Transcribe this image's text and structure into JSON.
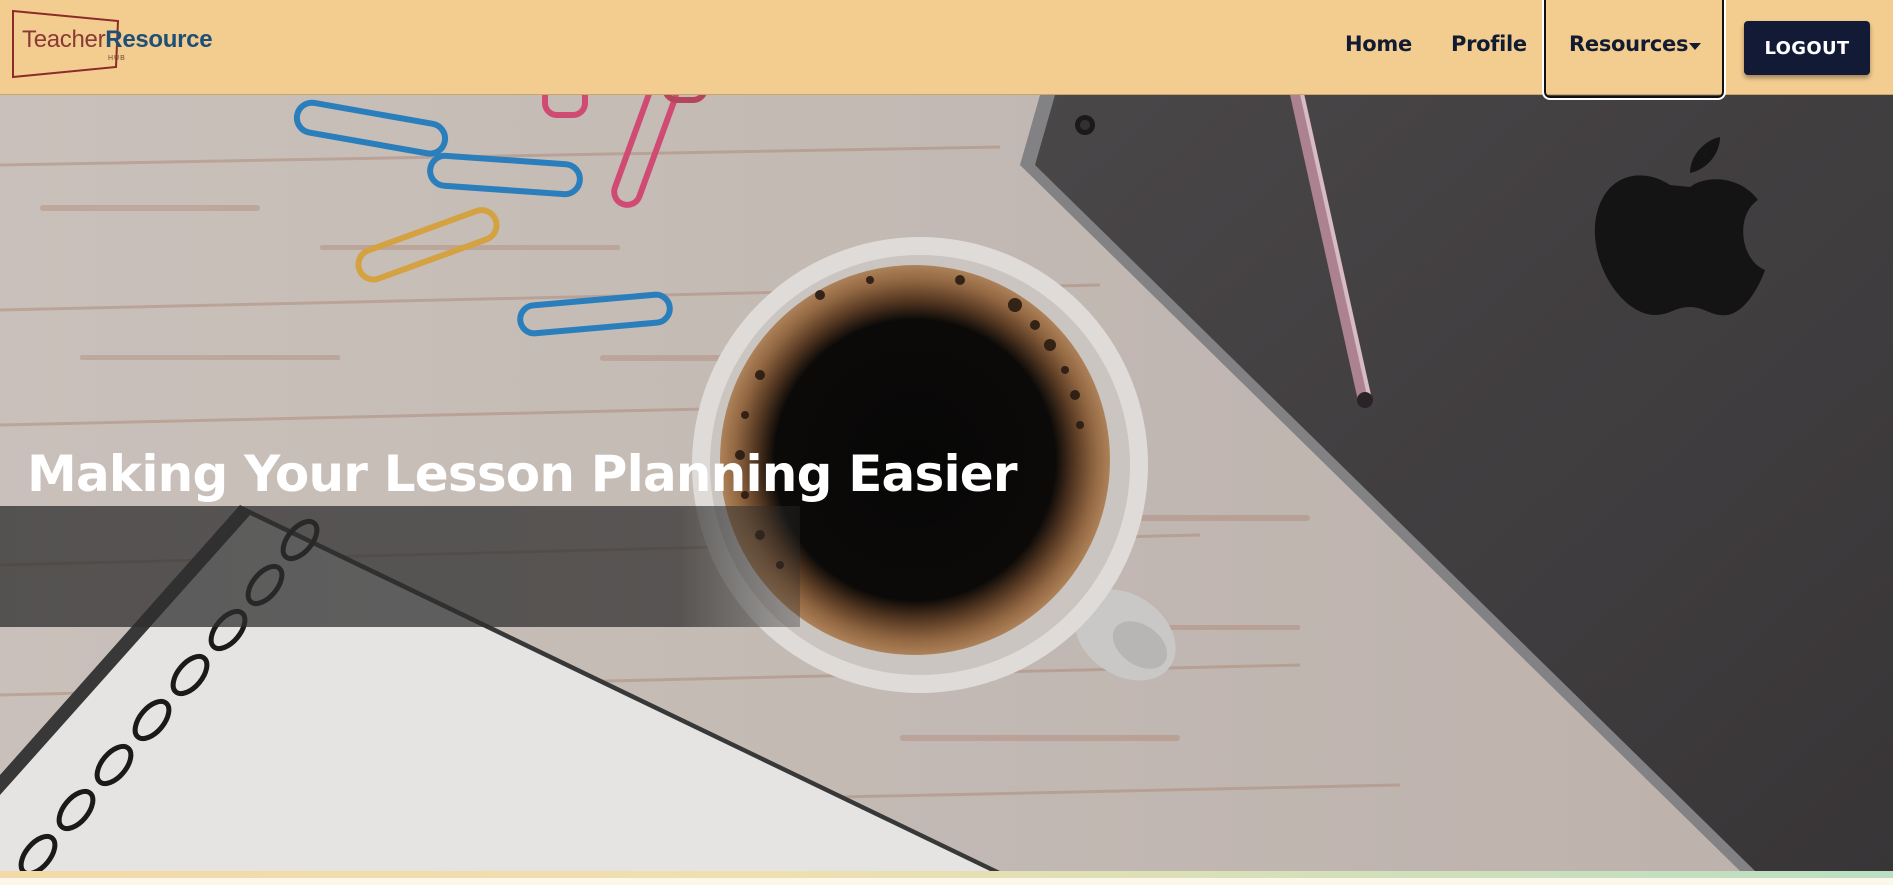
{
  "brand": {
    "part1": "Teacher",
    "part2": "Resource",
    "sub": "HUB"
  },
  "nav": {
    "home": "Home",
    "profile": "Profile",
    "resources": "Resources",
    "logout": "LOGOUT"
  },
  "hero": {
    "title": "Making Your Lesson Planning Easier"
  },
  "colors": {
    "navbar_bg": "#f3cc8f",
    "button_bg": "#121a36",
    "nav_text": "#111c33"
  },
  "icons": {
    "dropdown": "caret-down-icon"
  }
}
